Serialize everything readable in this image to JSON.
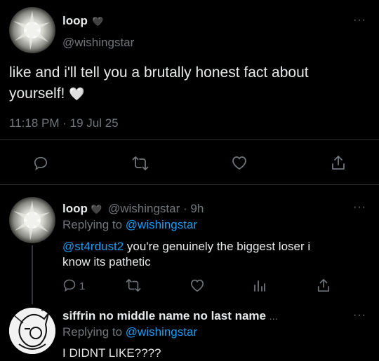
{
  "main_post": {
    "display_name": "loop",
    "name_emoji": "🖤",
    "handle": "@wishingstar",
    "text_line1": "like and i'll tell you a brutally honest fact about",
    "text_line2": "yourself!",
    "text_emoji": "🤍",
    "timestamp": "11:18 PM · 19 Jul 25",
    "menu": "···"
  },
  "reply1": {
    "display_name": "loop",
    "name_emoji": "🖤",
    "handle_time": "@wishingstar · 9h",
    "replying_prefix": "Replying to ",
    "replying_handle": "@wishingstar",
    "mention": "@st4rdust2",
    "text_rest": " you're genuinely the biggest loser i",
    "text_line2": "know its pathetic",
    "reply_count": "1",
    "menu": "···"
  },
  "reply2": {
    "display_name": "siffrin no middle name no last name",
    "name_ellipsis": "...",
    "replying_prefix": "Replying to ",
    "replying_handle": "@wishingstar",
    "text_partial": "I DIDNT LIKE????",
    "menu": "···"
  },
  "colors": {
    "background": "#000000",
    "text": "#e7e9ea",
    "muted": "#71767b",
    "link": "#1d9bf0",
    "divider": "#2f3336"
  },
  "icons": [
    "reply-icon",
    "retweet-icon",
    "like-icon",
    "share-icon",
    "views-icon",
    "heart-emoji",
    "more-icon"
  ]
}
